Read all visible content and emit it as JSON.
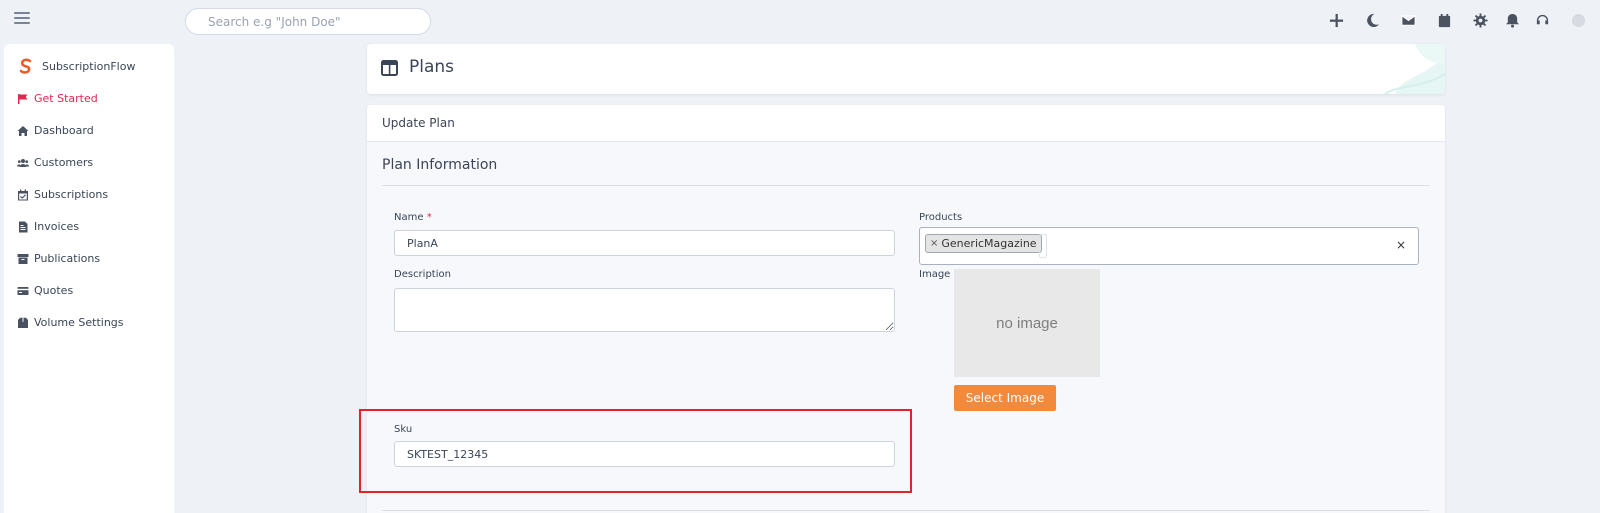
{
  "topbar": {
    "search_placeholder": "Search e.g \"John Doe\"",
    "icons": [
      "plus-icon",
      "moon-icon",
      "envelope-icon",
      "calendar-icon",
      "gear-icon",
      "bell-icon",
      "headset-icon"
    ]
  },
  "sidebar": {
    "brand": "SubscriptionFlow",
    "items": [
      {
        "label": "Get Started",
        "icon": "flag-icon",
        "active": true
      },
      {
        "label": "Dashboard",
        "icon": "home-icon"
      },
      {
        "label": "Customers",
        "icon": "users-icon"
      },
      {
        "label": "Subscriptions",
        "icon": "calendar-check-icon"
      },
      {
        "label": "Invoices",
        "icon": "invoice-icon"
      },
      {
        "label": "Publications",
        "icon": "archive-icon"
      },
      {
        "label": "Quotes",
        "icon": "card-icon"
      },
      {
        "label": "Volume Settings",
        "icon": "box-icon"
      }
    ]
  },
  "page": {
    "title": "Plans"
  },
  "form": {
    "card_title": "Update Plan",
    "section_title": "Plan Information",
    "name_label": "Name",
    "name_required_mark": "*",
    "name_value": "PlanA",
    "description_label": "Description",
    "description_value": "",
    "products_label": "Products",
    "products_tags": [
      "GenericMagazine"
    ],
    "tag_remove": "×",
    "clear": "×",
    "image_label": "Image",
    "image_placeholder": "no image",
    "select_image_label": "Select Image",
    "sku_label": "Sku",
    "sku_value": "SKTEST_12345"
  },
  "colors": {
    "accent": "#e0284f",
    "button_orange": "#f28a3e",
    "highlight_red": "#e3232a",
    "background": "#eef2f7"
  }
}
